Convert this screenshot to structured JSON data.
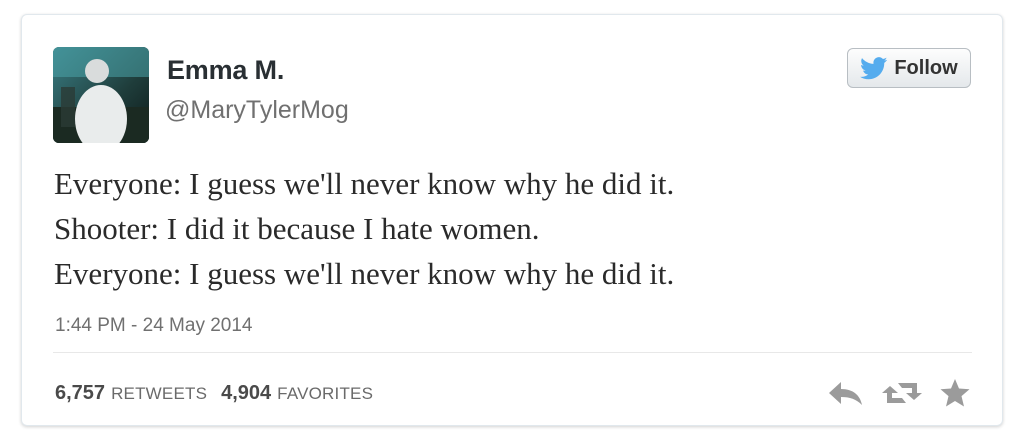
{
  "author": {
    "name": "Emma M.",
    "handle": "@MaryTylerMog",
    "avatar_icon": "user-photo-avatar"
  },
  "follow_button": {
    "label": "Follow",
    "icon": "twitter-bird-icon",
    "bird_color": "#55acee"
  },
  "tweet": {
    "lines": [
      "Everyone: I guess we'll never know why he did it.",
      "Shooter: I did it because I hate women.",
      "Everyone: I guess we'll never know why he did it."
    ],
    "timestamp": "1:44 PM - 24 May 2014"
  },
  "stats": {
    "retweets_count": "6,757",
    "retweets_label": "RETWEETS",
    "favorites_count": "4,904",
    "favorites_label": "FAVORITES"
  },
  "actions": [
    {
      "name": "reply",
      "icon": "reply-icon"
    },
    {
      "name": "retweet",
      "icon": "retweet-icon"
    },
    {
      "name": "favorite",
      "icon": "star-icon"
    }
  ],
  "colors": {
    "icon_gray": "#9b9b9b",
    "text_dark": "#292f33",
    "text_muted": "#707070"
  }
}
